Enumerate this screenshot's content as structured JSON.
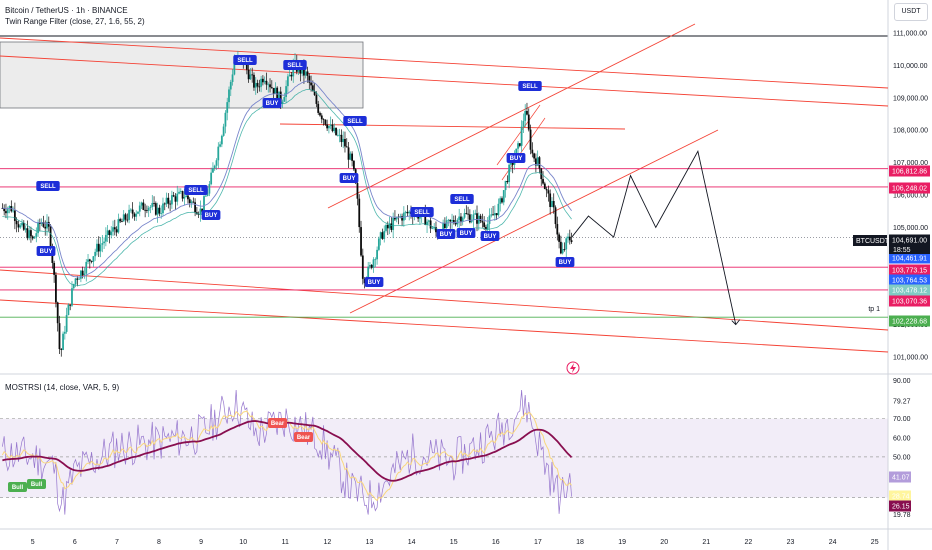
{
  "header": {
    "title": "Bitcoin / TetherUS · 1h · BINANCE",
    "indicator": "Twin Range Filter (close, 27, 1.6, 55, 2)",
    "currency": "USDT"
  },
  "rsi_header": "MOSTRSI (14, close, VAR, 5, 9)",
  "symbol_tag": "BTCUSDT",
  "countdown": "18:55",
  "tp_label": "tp 1",
  "colors": {
    "up": "#26a69a",
    "down": "#0b0b0b",
    "signal": "#1d2ed8",
    "trend_line": "#f44336",
    "level_line": "#e91e63",
    "tp_line": "#4caf50",
    "rsi_line": "#880e4f",
    "rsi_fill": "#ede7f6",
    "bull": "#4caf50",
    "bear": "#ef5350"
  },
  "price_axis": [
    "111,000.00",
    "110,000.00",
    "109,000.00",
    "108,000.00",
    "107,000.00",
    "106,000.00",
    "105,000.00",
    "102,000.00",
    "101,000.00"
  ],
  "price_tags": [
    {
      "value": "106,812.86",
      "color": "#e91e63"
    },
    {
      "value": "106,248.02",
      "color": "#e91e63"
    },
    {
      "value": "104,691.00",
      "color": "#131722"
    },
    {
      "value": "104,461.91",
      "color": "#2962ff"
    },
    {
      "value": "103,773.15",
      "color": "#e91e63"
    },
    {
      "value": "103,764.53",
      "color": "#2962ff"
    },
    {
      "value": "103,478.12",
      "color": "#80cbc4"
    },
    {
      "value": "103,070.36",
      "color": "#e91e63"
    },
    {
      "value": "102,228.68",
      "color": "#4caf50"
    }
  ],
  "rsi_axis": [
    "90.00",
    "79.27",
    "70.00",
    "60.00",
    "50.00",
    "19.78"
  ],
  "rsi_tags": [
    {
      "value": "41.07",
      "color": "#b39ddb"
    },
    {
      "value": "28.74",
      "color": "#fff59d"
    },
    {
      "value": "26.15",
      "color": "#880e4f"
    }
  ],
  "time_axis": [
    "5",
    "6",
    "7",
    "8",
    "9",
    "10",
    "11",
    "12",
    "13",
    "14",
    "15",
    "16",
    "17",
    "18",
    "19",
    "20",
    "21",
    "22",
    "23",
    "24",
    "25"
  ],
  "signals": [
    {
      "label": "SELL",
      "type": "sell"
    },
    {
      "label": "BUY",
      "type": "buy"
    },
    {
      "label": "SELL",
      "type": "sell"
    },
    {
      "label": "BUY",
      "type": "buy"
    },
    {
      "label": "SELL",
      "type": "sell"
    },
    {
      "label": "SELL",
      "type": "sell"
    },
    {
      "label": "BUY",
      "type": "buy"
    },
    {
      "label": "SELL",
      "type": "sell"
    },
    {
      "label": "BUY",
      "type": "buy"
    },
    {
      "label": "SELL",
      "type": "sell"
    },
    {
      "label": "BUY",
      "type": "buy"
    },
    {
      "label": "BUY",
      "type": "buy"
    },
    {
      "label": "BUY",
      "type": "buy"
    },
    {
      "label": "BUY",
      "type": "buy"
    },
    {
      "label": "SELL",
      "type": "sell"
    },
    {
      "label": "BUY",
      "type": "buy"
    },
    {
      "label": "SELL",
      "type": "sell"
    },
    {
      "label": "BUY",
      "type": "buy"
    }
  ],
  "rsi_labels": [
    "Bull",
    "Bull",
    "Bear",
    "Bear"
  ],
  "chart_data": [
    {
      "type": "candlestick",
      "symbol": "BTCUSDT",
      "timeframe": "1h",
      "y_range": [
        100800,
        111300
      ],
      "x_categories": [
        "5",
        "6",
        "7",
        "8",
        "9",
        "10",
        "11",
        "12",
        "13",
        "14",
        "15",
        "16",
        "17",
        "18"
      ],
      "close_path": [
        {
          "day": 4.5,
          "price": 105600
        },
        {
          "day": 4.7,
          "price": 105000
        },
        {
          "day": 4.9,
          "price": 104800
        },
        {
          "day": 5.0,
          "price": 104600
        },
        {
          "day": 5.2,
          "price": 105200
        },
        {
          "day": 5.4,
          "price": 104900
        },
        {
          "day": 5.55,
          "price": 102900
        },
        {
          "day": 5.65,
          "price": 101000
        },
        {
          "day": 5.8,
          "price": 102200
        },
        {
          "day": 6.0,
          "price": 103400
        },
        {
          "day": 6.2,
          "price": 103700
        },
        {
          "day": 6.5,
          "price": 104300
        },
        {
          "day": 6.9,
          "price": 104900
        },
        {
          "day": 7.3,
          "price": 105400
        },
        {
          "day": 7.7,
          "price": 105700
        },
        {
          "day": 8.0,
          "price": 105500
        },
        {
          "day": 8.3,
          "price": 105900
        },
        {
          "day": 8.6,
          "price": 106000
        },
        {
          "day": 8.9,
          "price": 105600
        },
        {
          "day": 9.0,
          "price": 105500
        },
        {
          "day": 9.2,
          "price": 106300
        },
        {
          "day": 9.5,
          "price": 108000
        },
        {
          "day": 9.8,
          "price": 110200
        },
        {
          "day": 10.0,
          "price": 110100
        },
        {
          "day": 10.3,
          "price": 109300
        },
        {
          "day": 10.5,
          "price": 109700
        },
        {
          "day": 10.9,
          "price": 108900
        },
        {
          "day": 11.2,
          "price": 110000
        },
        {
          "day": 11.5,
          "price": 109700
        },
        {
          "day": 11.8,
          "price": 108600
        },
        {
          "day": 12.1,
          "price": 108000
        },
        {
          "day": 12.4,
          "price": 107600
        },
        {
          "day": 12.6,
          "price": 106900
        },
        {
          "day": 12.7,
          "price": 106000
        },
        {
          "day": 12.85,
          "price": 103400
        },
        {
          "day": 13.0,
          "price": 103700
        },
        {
          "day": 13.3,
          "price": 104800
        },
        {
          "day": 13.7,
          "price": 105300
        },
        {
          "day": 14.0,
          "price": 105500
        },
        {
          "day": 14.3,
          "price": 105300
        },
        {
          "day": 14.6,
          "price": 104800
        },
        {
          "day": 14.9,
          "price": 105100
        },
        {
          "day": 15.2,
          "price": 105400
        },
        {
          "day": 15.5,
          "price": 105300
        },
        {
          "day": 15.8,
          "price": 105100
        },
        {
          "day": 16.1,
          "price": 105700
        },
        {
          "day": 16.3,
          "price": 106700
        },
        {
          "day": 16.55,
          "price": 107500
        },
        {
          "day": 16.7,
          "price": 108700
        },
        {
          "day": 16.85,
          "price": 107300
        },
        {
          "day": 17.0,
          "price": 107000
        },
        {
          "day": 17.2,
          "price": 106100
        },
        {
          "day": 17.4,
          "price": 105400
        },
        {
          "day": 17.55,
          "price": 104100
        },
        {
          "day": 17.7,
          "price": 104600
        },
        {
          "day": 17.8,
          "price": 104691
        }
      ],
      "projection": [
        {
          "day": 17.8,
          "price": 104691
        },
        {
          "day": 18.2,
          "price": 105350
        },
        {
          "day": 18.8,
          "price": 104700
        },
        {
          "day": 19.2,
          "price": 106600
        },
        {
          "day": 19.8,
          "price": 105000
        },
        {
          "day": 20.8,
          "price": 107350
        },
        {
          "day": 21.7,
          "price": 102000
        }
      ],
      "horizontal_levels": [
        106812.86,
        106248.02,
        103773.15,
        103070.36,
        102228.68
      ],
      "last_price": 104691.0
    },
    {
      "type": "line",
      "name": "MOSTRSI",
      "y_range": [
        18,
        91
      ],
      "levels": [
        70,
        50,
        28.74
      ],
      "last_values": {
        "rsi": 41.07,
        "signal": 28.74,
        "most": 26.15
      }
    }
  ]
}
